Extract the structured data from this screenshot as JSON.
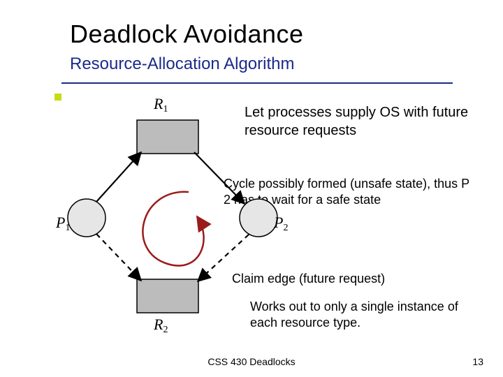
{
  "title": "Deadlock Avoidance",
  "subtitle": "Resource-Allocation Algorithm",
  "intro": "Let processes supply OS with future resource requests",
  "cycle": "Cycle possibly formed (unsafe state), thus P 2 has to wait for a safe state",
  "claim": "Claim edge (future request)",
  "works": "Works out to only a single instance of each resource type.",
  "footer": "CSS 430 Deadlocks",
  "page": "13",
  "nodes": {
    "r1": "R",
    "r1_sub": "1",
    "r2": "R",
    "r2_sub": "2",
    "p1": "P",
    "p1_sub": "1",
    "p2": "P",
    "p2_sub": "2"
  }
}
